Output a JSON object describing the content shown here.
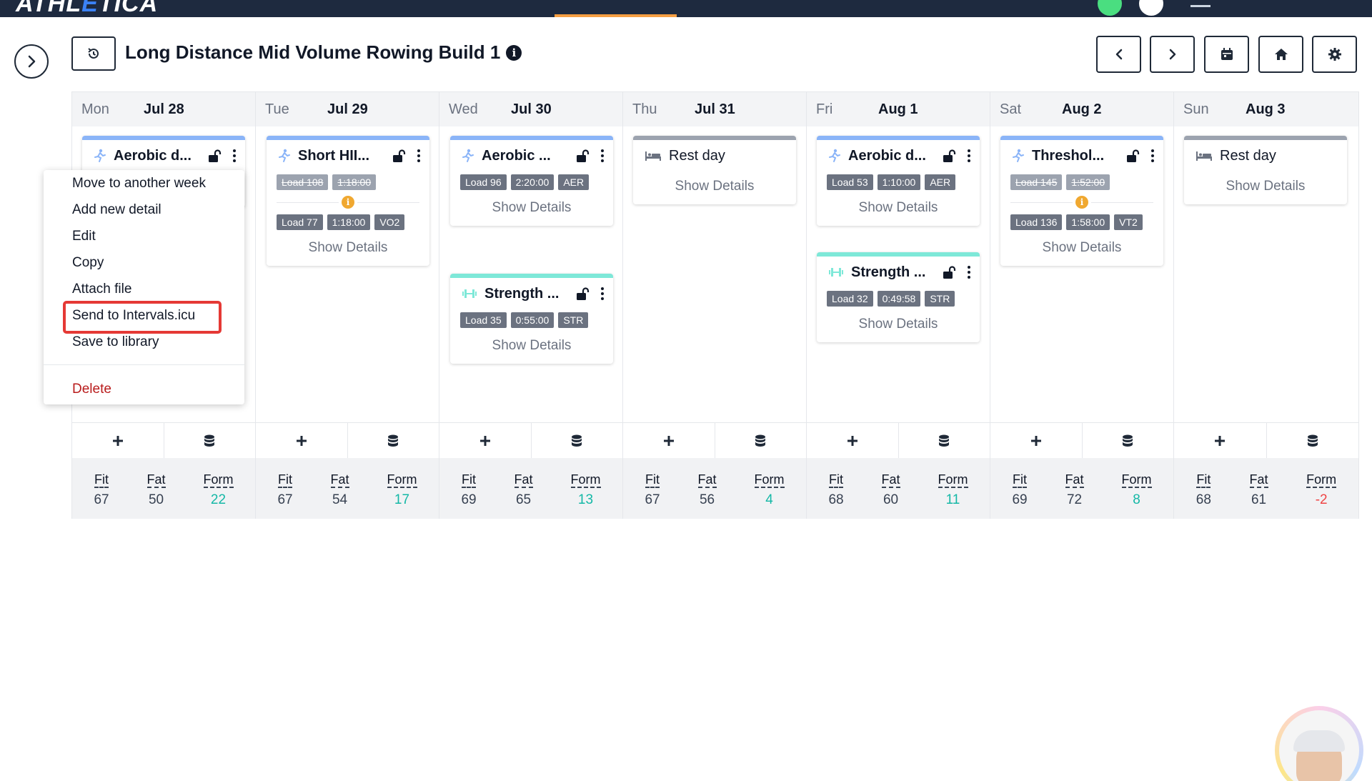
{
  "app": {
    "logo_text_left": "ATHL",
    "logo_text_mid": "E",
    "logo_text_right": "TICA"
  },
  "header": {
    "title": "Long Distance Mid Volume Rowing Build 1",
    "info_icon": "i"
  },
  "days": [
    {
      "dow": "Mon",
      "date": "Jul 28",
      "fit": "67",
      "fat": "50",
      "form": "22",
      "form_sign": "pos"
    },
    {
      "dow": "Tue",
      "date": "Jul 29",
      "fit": "67",
      "fat": "54",
      "form": "17",
      "form_sign": "pos"
    },
    {
      "dow": "Wed",
      "date": "Jul 30",
      "fit": "69",
      "fat": "65",
      "form": "13",
      "form_sign": "pos"
    },
    {
      "dow": "Thu",
      "date": "Jul 31",
      "fit": "67",
      "fat": "56",
      "form": "4",
      "form_sign": "pos"
    },
    {
      "dow": "Fri",
      "date": "Aug 1",
      "fit": "68",
      "fat": "60",
      "form": "11",
      "form_sign": "pos"
    },
    {
      "dow": "Sat",
      "date": "Aug 2",
      "fit": "69",
      "fat": "72",
      "form": "8",
      "form_sign": "pos"
    },
    {
      "dow": "Sun",
      "date": "Aug 3",
      "fit": "68",
      "fat": "61",
      "form": "-2",
      "form_sign": "neg"
    }
  ],
  "stat_labels": {
    "fit": "Fit",
    "fat": "Fat",
    "form": "Form"
  },
  "show_details": "Show Details",
  "cards": {
    "mon_aerobic": {
      "title": "Aerobic d..."
    },
    "tue_short": {
      "title": "Short HII...",
      "old_load": "Load 108",
      "old_time": "1:18:00",
      "load": "Load 77",
      "time": "1:18:00",
      "zone": "VO2"
    },
    "wed_aerobic": {
      "title": "Aerobic ...",
      "load": "Load 96",
      "time": "2:20:00",
      "zone": "AER"
    },
    "wed_strength": {
      "title": "Strength ...",
      "load": "Load 35",
      "time": "0:55:00",
      "zone": "STR"
    },
    "thu_rest": {
      "title": "Rest day"
    },
    "fri_aerobic": {
      "title": "Aerobic d...",
      "load": "Load 53",
      "time": "1:10:00",
      "zone": "AER"
    },
    "fri_strength": {
      "title": "Strength ...",
      "load": "Load 32",
      "time": "0:49:58",
      "zone": "STR"
    },
    "sat_threshold": {
      "title": "Threshol...",
      "old_load": "Load 145",
      "old_time": "1:52:00",
      "load": "Load 136",
      "time": "1:58:00",
      "zone": "VT2"
    },
    "sun_rest": {
      "title": "Rest day"
    }
  },
  "context_menu": {
    "items": [
      "Move to another week",
      "Add new detail",
      "Edit",
      "Copy",
      "Attach file",
      "Send to Intervals.icu",
      "Save to library"
    ],
    "delete": "Delete"
  },
  "colors": {
    "nav_bg": "#1e2a3f",
    "accent_orange": "#f59e42",
    "endurance_top": "#8ab4f8",
    "strength_top": "#7ee8d8",
    "form_positive": "#14b8a6",
    "form_negative": "#ef4444",
    "highlight": "#e53935"
  }
}
